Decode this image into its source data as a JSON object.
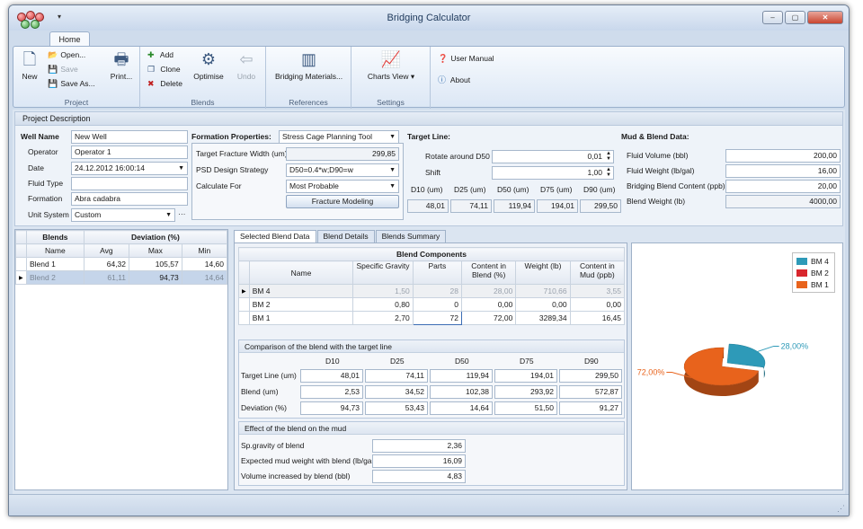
{
  "window": {
    "title": "Bridging Calculator",
    "qat_arrow": "▾",
    "min": "–",
    "max": "▢",
    "close": "✕"
  },
  "ribbon": {
    "tab": "Home",
    "groups": {
      "project": "Project",
      "blends": "Blends",
      "references": "References",
      "settings": "Settings"
    },
    "new": "New",
    "open": "Open...",
    "save": "Save",
    "save_as": "Save As...",
    "print": "Print...",
    "add": "Add",
    "clone": "Clone",
    "delete": "Delete",
    "optimise": "Optimise",
    "undo": "Undo",
    "bridging_materials": "Bridging Materials...",
    "charts_view": "Charts View",
    "user_manual": "User Manual",
    "about": "About"
  },
  "project": {
    "header": "Project Description",
    "well_name_label": "Well Name",
    "well_name": "New Well",
    "operator_label": "Operator",
    "operator": "Operator 1",
    "date_label": "Date",
    "date": "24.12.2012 16:00:14",
    "fluid_type_label": "Fluid Type",
    "fluid_type": "",
    "formation_label": "Formation",
    "formation": "Abra cadabra",
    "unit_system_label": "Unit System",
    "unit_system": "Custom",
    "ellipsis": "···"
  },
  "formation": {
    "label": "Formation Properties:",
    "mode": "Stress Cage Planning Tool",
    "target_width_label": "Target Fracture Width (um)",
    "target_width": "299,85",
    "psd_label": "PSD Design Strategy",
    "psd": "D50=0.4*w;D90=w",
    "calc_label": "Calculate For",
    "calc": "Most Probable",
    "modeling_button": "Fracture Modeling"
  },
  "target_line": {
    "label": "Target Line:",
    "rotate_label": "Rotate around D50",
    "rotate": "0,01",
    "shift_label": "Shift",
    "shift": "1,00",
    "headers": [
      "D10 (um)",
      "D25 (um)",
      "D50 (um)",
      "D75 (um)",
      "D90 (um)"
    ],
    "values": [
      "48,01",
      "74,11",
      "119,94",
      "194,01",
      "299,50"
    ]
  },
  "mud": {
    "label": "Mud & Blend Data:",
    "fluid_volume_label": "Fluid Volume (bbl)",
    "fluid_volume": "200,00",
    "fluid_weight_label": "Fluid Weight (lb/gal)",
    "fluid_weight": "16,00",
    "bridging_content_label": "Bridging Blend Content (ppb)",
    "bridging_content": "20,00",
    "blend_weight_label": "Blend Weight (lb)",
    "blend_weight": "4000,00"
  },
  "blends_table": {
    "h_blends": "Blends",
    "h_deviation": "Deviation (%)",
    "cols": [
      "Name",
      "Avg",
      "Max",
      "Min"
    ],
    "rows": [
      {
        "name": "Blend 1",
        "avg": "64,32",
        "max": "105,57",
        "min": "14,60"
      },
      {
        "name": "Blend 2",
        "avg": "61,11",
        "max": "94,73",
        "min": "14,64"
      }
    ]
  },
  "tabs": [
    "Selected Blend Data",
    "Blend Details",
    "Blends Summary"
  ],
  "components": {
    "header": "Blend Components",
    "cols": [
      "Name",
      "Specific Gravity",
      "Parts",
      "Content in Blend (%)",
      "Weight (lb)",
      "Content in Mud (ppb)"
    ],
    "rows": [
      {
        "name": "BM 4",
        "sg": "1,50",
        "parts": "28",
        "content": "28,00",
        "weight": "710,66",
        "mud": "3,55"
      },
      {
        "name": "BM 2",
        "sg": "0,80",
        "parts": "0",
        "content": "0,00",
        "weight": "0,00",
        "mud": "0,00"
      },
      {
        "name": "BM 1",
        "sg": "2,70",
        "parts": "72",
        "content": "72,00",
        "weight": "3289,34",
        "mud": "16,45"
      }
    ]
  },
  "comparison": {
    "header": "Comparison of the blend with the target line",
    "cols": [
      "D10",
      "D25",
      "D50",
      "D75",
      "D90"
    ],
    "rows": [
      {
        "label": "Target Line (um)",
        "values": [
          "48,01",
          "74,11",
          "119,94",
          "194,01",
          "299,50"
        ]
      },
      {
        "label": "Blend (um)",
        "values": [
          "2,53",
          "34,52",
          "102,38",
          "293,92",
          "572,87"
        ]
      },
      {
        "label": "Deviation (%)",
        "values": [
          "94,73",
          "53,43",
          "14,64",
          "51,50",
          "91,27"
        ]
      }
    ]
  },
  "effect": {
    "header": "Effect of the blend on the mud",
    "rows": [
      {
        "label": "Sp.gravity of blend",
        "value": "2,36"
      },
      {
        "label": "Expected mud weight with blend (lb/gal)",
        "value": "16,09"
      },
      {
        "label": "Volume increased by blend (bbl)",
        "value": "4,83"
      }
    ]
  },
  "chart_data": {
    "type": "pie",
    "categories": [
      "BM 4",
      "BM 2",
      "BM 1"
    ],
    "values": [
      28.0,
      0.0,
      72.0
    ],
    "labels": [
      "28,00%",
      "",
      "72,00%"
    ],
    "colors": [
      "#2e9ab8",
      "#d8262d",
      "#e8631c"
    ],
    "legend": "top-right"
  }
}
